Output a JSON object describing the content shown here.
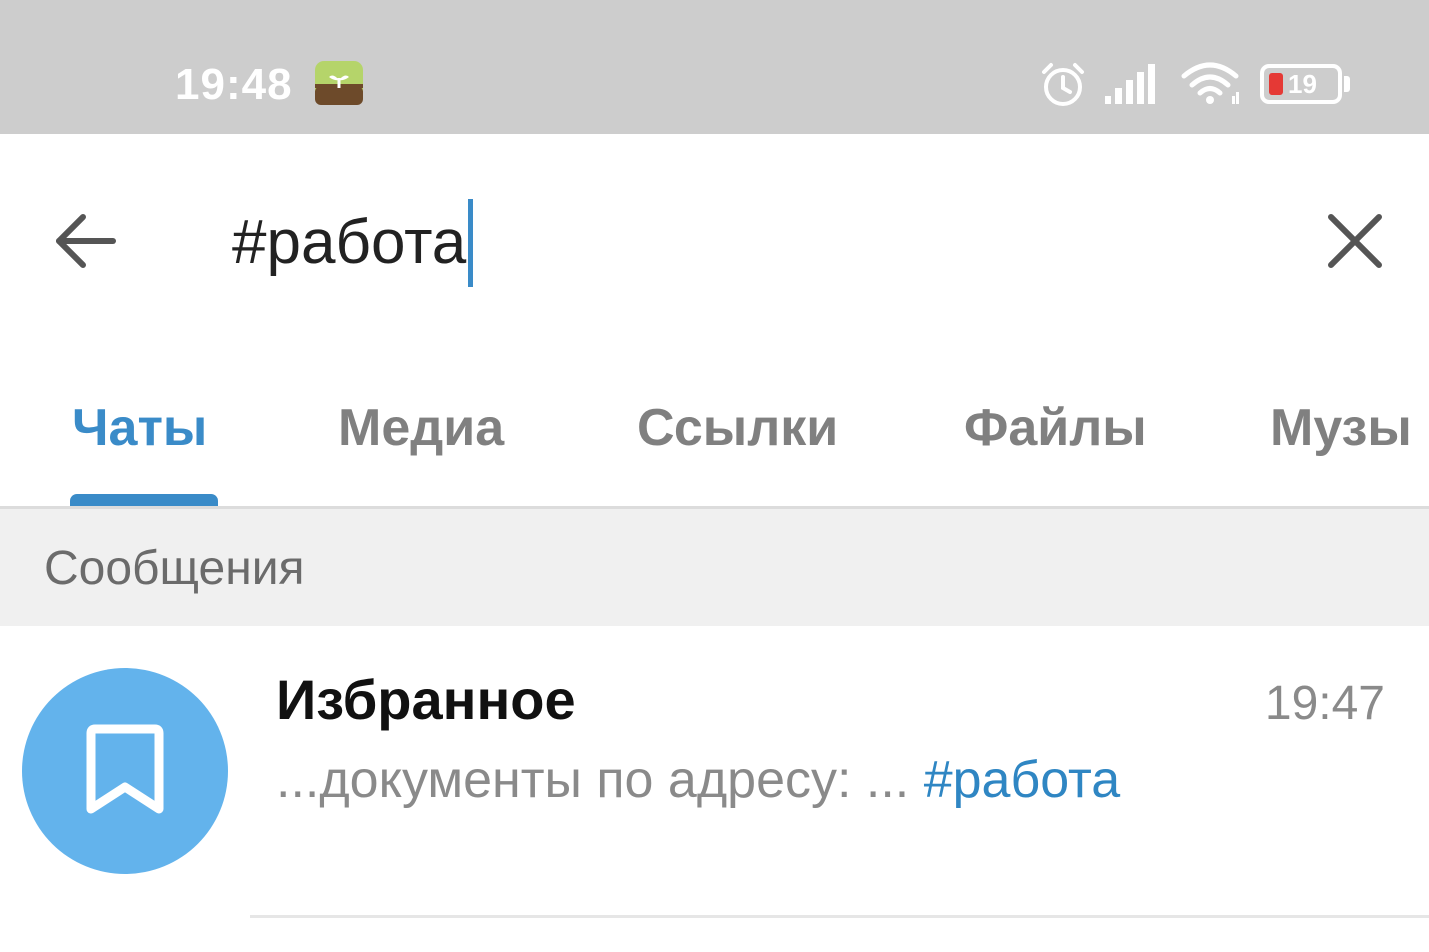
{
  "status_bar": {
    "time": "19:48",
    "battery_text": "19",
    "battery_level": 0.19,
    "icons": [
      "forest-app-icon",
      "alarm-icon",
      "signal-icon",
      "wifi-icon",
      "battery-icon"
    ]
  },
  "search": {
    "query": "#работа",
    "back_icon": "arrow-left-icon",
    "clear_icon": "close-icon"
  },
  "tabs": [
    {
      "label": "Чаты",
      "active": true
    },
    {
      "label": "Медиа",
      "active": false
    },
    {
      "label": "Ссылки",
      "active": false
    },
    {
      "label": "Файлы",
      "active": false
    },
    {
      "label": "Музы",
      "active": false
    }
  ],
  "section": {
    "title": "Сообщения"
  },
  "results": [
    {
      "name": "Избранное",
      "time": "19:47",
      "preview_text": "...документы по адресу: ... ",
      "preview_hashtag": "#работа",
      "avatar_icon": "bookmark-icon",
      "avatar_color": "#63b3ec"
    }
  ],
  "colors": {
    "accent": "#3a8bc8",
    "status_bar_bg": "#cdcdcd",
    "battery_low": "#e53935"
  }
}
